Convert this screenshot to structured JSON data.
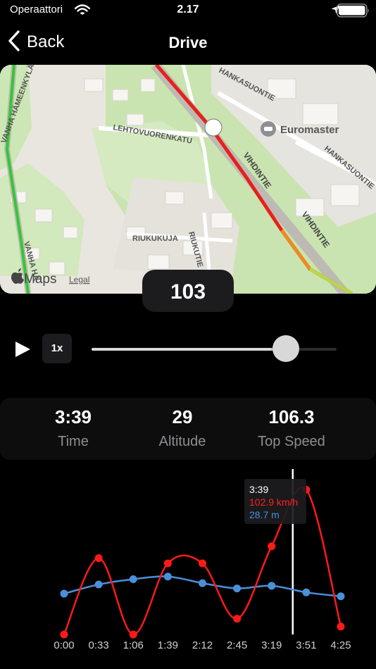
{
  "status_bar": {
    "carrier": "Operaattori",
    "time": "2.17"
  },
  "nav": {
    "back_label": "Back",
    "title": "Drive"
  },
  "map": {
    "streets": [
      "VANHA HÄMEENKYLÄN",
      "LEHTOVUORENKATU",
      "HANKASUONTIE",
      "VIHDINTIE",
      "VIHDINTIE",
      "HANKASUONTIE",
      "RIUKUKUJA",
      "RIUKUTIE",
      "VANHA HÄ"
    ],
    "poi": "Euromaster",
    "attribution": {
      "brand": "Maps",
      "legal": "Legal"
    }
  },
  "current_speed": "103",
  "playback": {
    "rate": "1x",
    "progress": 0.794
  },
  "stats": [
    {
      "value": "3:39",
      "label": "Time"
    },
    {
      "value": "29",
      "label": "Altitude"
    },
    {
      "value": "106.3",
      "label": "Top Speed"
    }
  ],
  "tooltip": {
    "time": "3:39",
    "speed": "102.9 km/h",
    "altitude": "28.7 m"
  },
  "chart_data": {
    "type": "line",
    "categories": [
      "0:00",
      "0:33",
      "1:06",
      "1:39",
      "2:12",
      "2:45",
      "3:19",
      "3:51",
      "4:25"
    ],
    "cursor": "3:39",
    "series": [
      {
        "color": "#ff1a1a",
        "values": [
          0,
          58,
          0,
          54,
          54,
          12,
          67,
          110,
          6
        ]
      },
      {
        "color": "#4a90d9",
        "values": [
          31,
          38,
          42,
          44,
          39,
          35,
          37,
          32,
          29
        ]
      }
    ],
    "ylim": [
      0,
      115
    ],
    "grid": false
  }
}
